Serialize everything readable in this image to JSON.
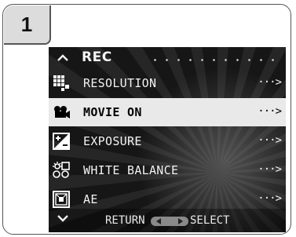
{
  "step": {
    "number": "1"
  },
  "menu": {
    "title": "REC",
    "items": [
      {
        "label": "RESOLUTION",
        "icon": "resolution-icon",
        "arrow": "···>"
      },
      {
        "label": "MOVIE ON",
        "icon": "movie-camera-icon",
        "arrow": "···>",
        "selected": true
      },
      {
        "label": "EXPOSURE",
        "icon": "exposure-compensation-icon",
        "arrow": "···>"
      },
      {
        "label": "WHITE BALANCE",
        "icon": "white-balance-icon",
        "arrow": "···>"
      },
      {
        "label": "AE",
        "icon": "ae-metering-icon",
        "arrow": "···>"
      }
    ]
  },
  "footer": {
    "left_label": "RETURN",
    "right_label": "SELECT"
  },
  "colors": {
    "screen_bg": "#161616",
    "highlight": "#e9e9e9",
    "text": "#f2f2f2"
  }
}
